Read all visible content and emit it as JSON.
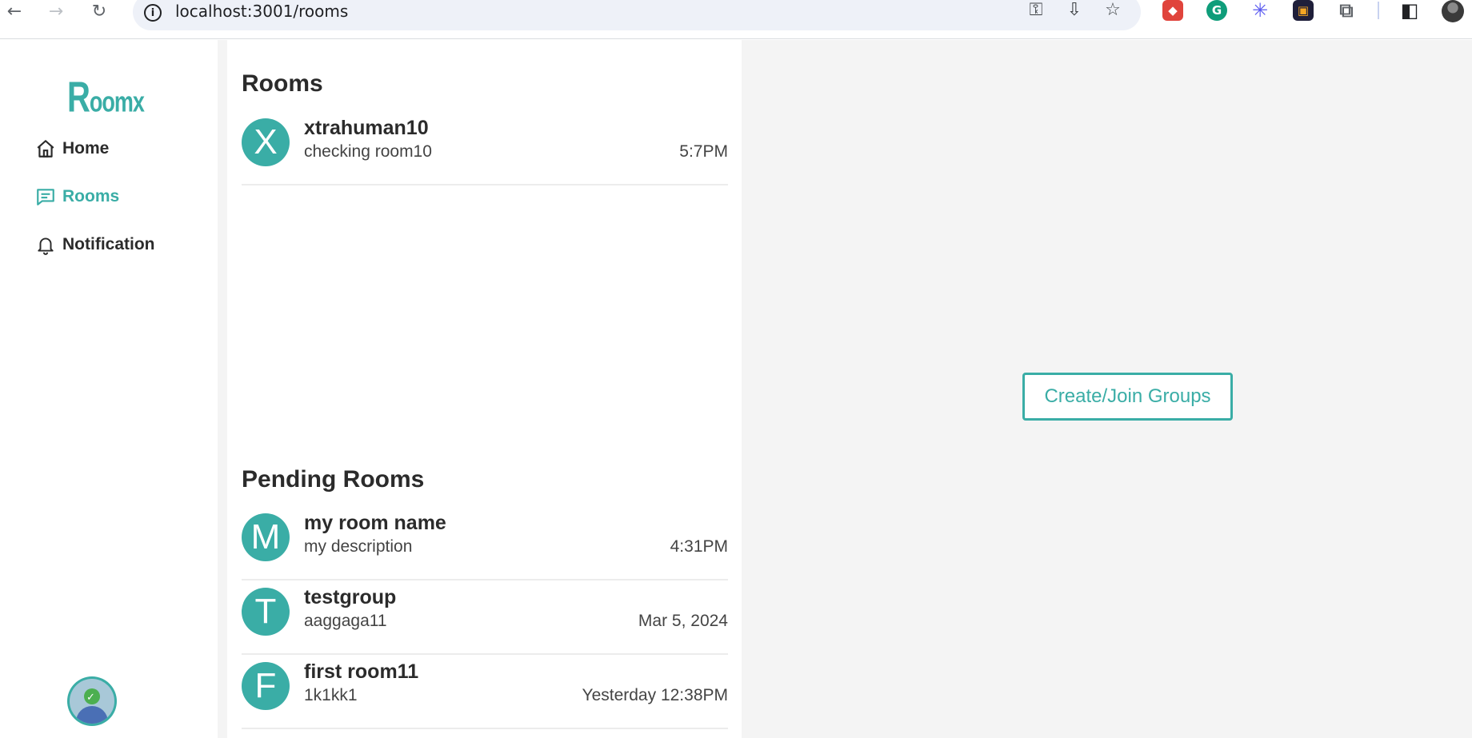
{
  "browser": {
    "url": "localhost:3001/rooms",
    "nav": {
      "back_icon": "←",
      "forward_icon": "→",
      "reload_icon": "↻"
    },
    "omnibox_icons": {
      "key_icon": "⚿",
      "install_icon": "⇩",
      "star_icon": "☆"
    },
    "extensions": [
      {
        "name": "ext-red",
        "glyph": "◆",
        "color": "#e0443c"
      },
      {
        "name": "grammarly",
        "glyph": "G",
        "color": "#15c39a"
      },
      {
        "name": "ext-star",
        "glyph": "✳",
        "color": "#5a5af0"
      },
      {
        "name": "ext-colorful",
        "glyph": "▣",
        "color": "#1f1f3a"
      },
      {
        "name": "puzzle",
        "glyph": "⧉",
        "color": "#5f6368"
      },
      {
        "name": "sidepanel",
        "glyph": "◧",
        "color": "#202124"
      }
    ]
  },
  "app": {
    "logo": {
      "first": "R",
      "rest": "oomx"
    },
    "nav": {
      "home": "Home",
      "rooms": "Rooms",
      "notification": "Notification"
    },
    "accent_color": "#3aada6"
  },
  "rooms": {
    "title": "Rooms",
    "items": [
      {
        "initial": "X",
        "name": "xtrahuman10",
        "description": "checking room10",
        "time": "5:7PM"
      }
    ]
  },
  "pending": {
    "title": "Pending Rooms",
    "items": [
      {
        "initial": "M",
        "name": "my room name",
        "description": "my description",
        "time": "4:31PM"
      },
      {
        "initial": "T",
        "name": "testgroup",
        "description": "aaggaga11",
        "time": "Mar 5, 2024"
      },
      {
        "initial": "F",
        "name": "first room11",
        "description": "1k1kk1",
        "time": "Yesterday 12:38PM"
      }
    ]
  },
  "main": {
    "cta_label": "Create/Join Groups"
  }
}
